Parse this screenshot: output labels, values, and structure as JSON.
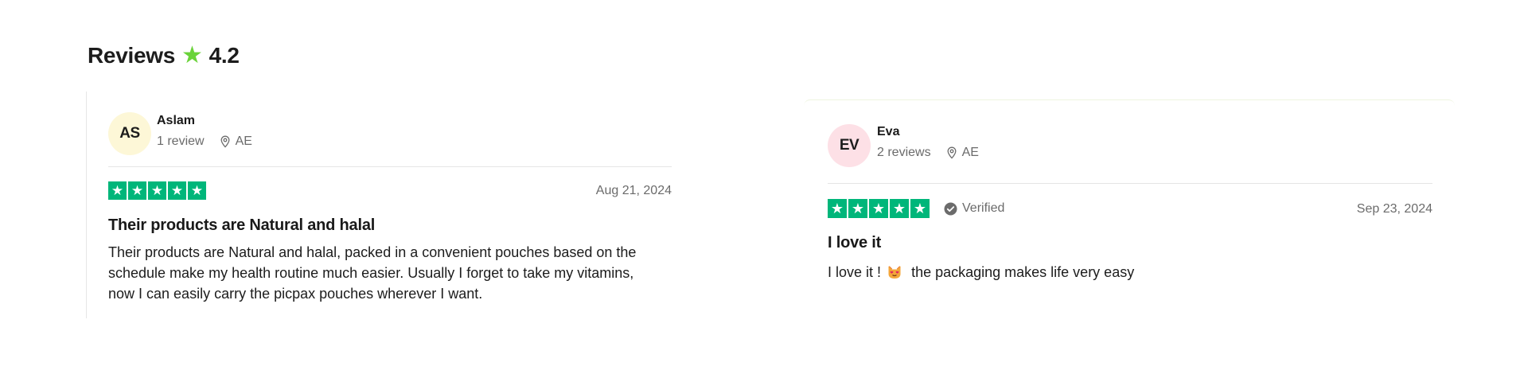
{
  "header": {
    "title": "Reviews",
    "star_icon": "star-icon",
    "rating": "4.2",
    "star_color": "#6ad33a"
  },
  "colors": {
    "trustpilot_green": "#00b67a",
    "meta_text": "#6b6b6b",
    "avatar_yellow": "#fdf7d7",
    "avatar_pink": "#fde0e6"
  },
  "reviews": [
    {
      "initials": "AS",
      "name": "Aslam",
      "review_count": "1 review",
      "location": "AE",
      "rating_stars": 5,
      "verified": false,
      "date": "Aug 21, 2024",
      "title": "Their products are Natural and halal",
      "body_lines": [
        "Their products are Natural and halal, packed in a convenient pouches based on the",
        "schedule make my health routine much easier. Usually I forget to take my vitamins,",
        "now I can easily carry the picpax pouches wherever I want."
      ]
    },
    {
      "initials": "EV",
      "name": "Eva",
      "review_count": "2 reviews",
      "location": "AE",
      "rating_stars": 5,
      "verified": true,
      "verified_label": "Verified",
      "date": "Sep 23, 2024",
      "title": "I love it",
      "body_before_emoji": "I love it !",
      "body_emoji_icon": "heart-eyes-cat-emoji",
      "body_after_emoji": "the packaging makes life very easy"
    }
  ]
}
